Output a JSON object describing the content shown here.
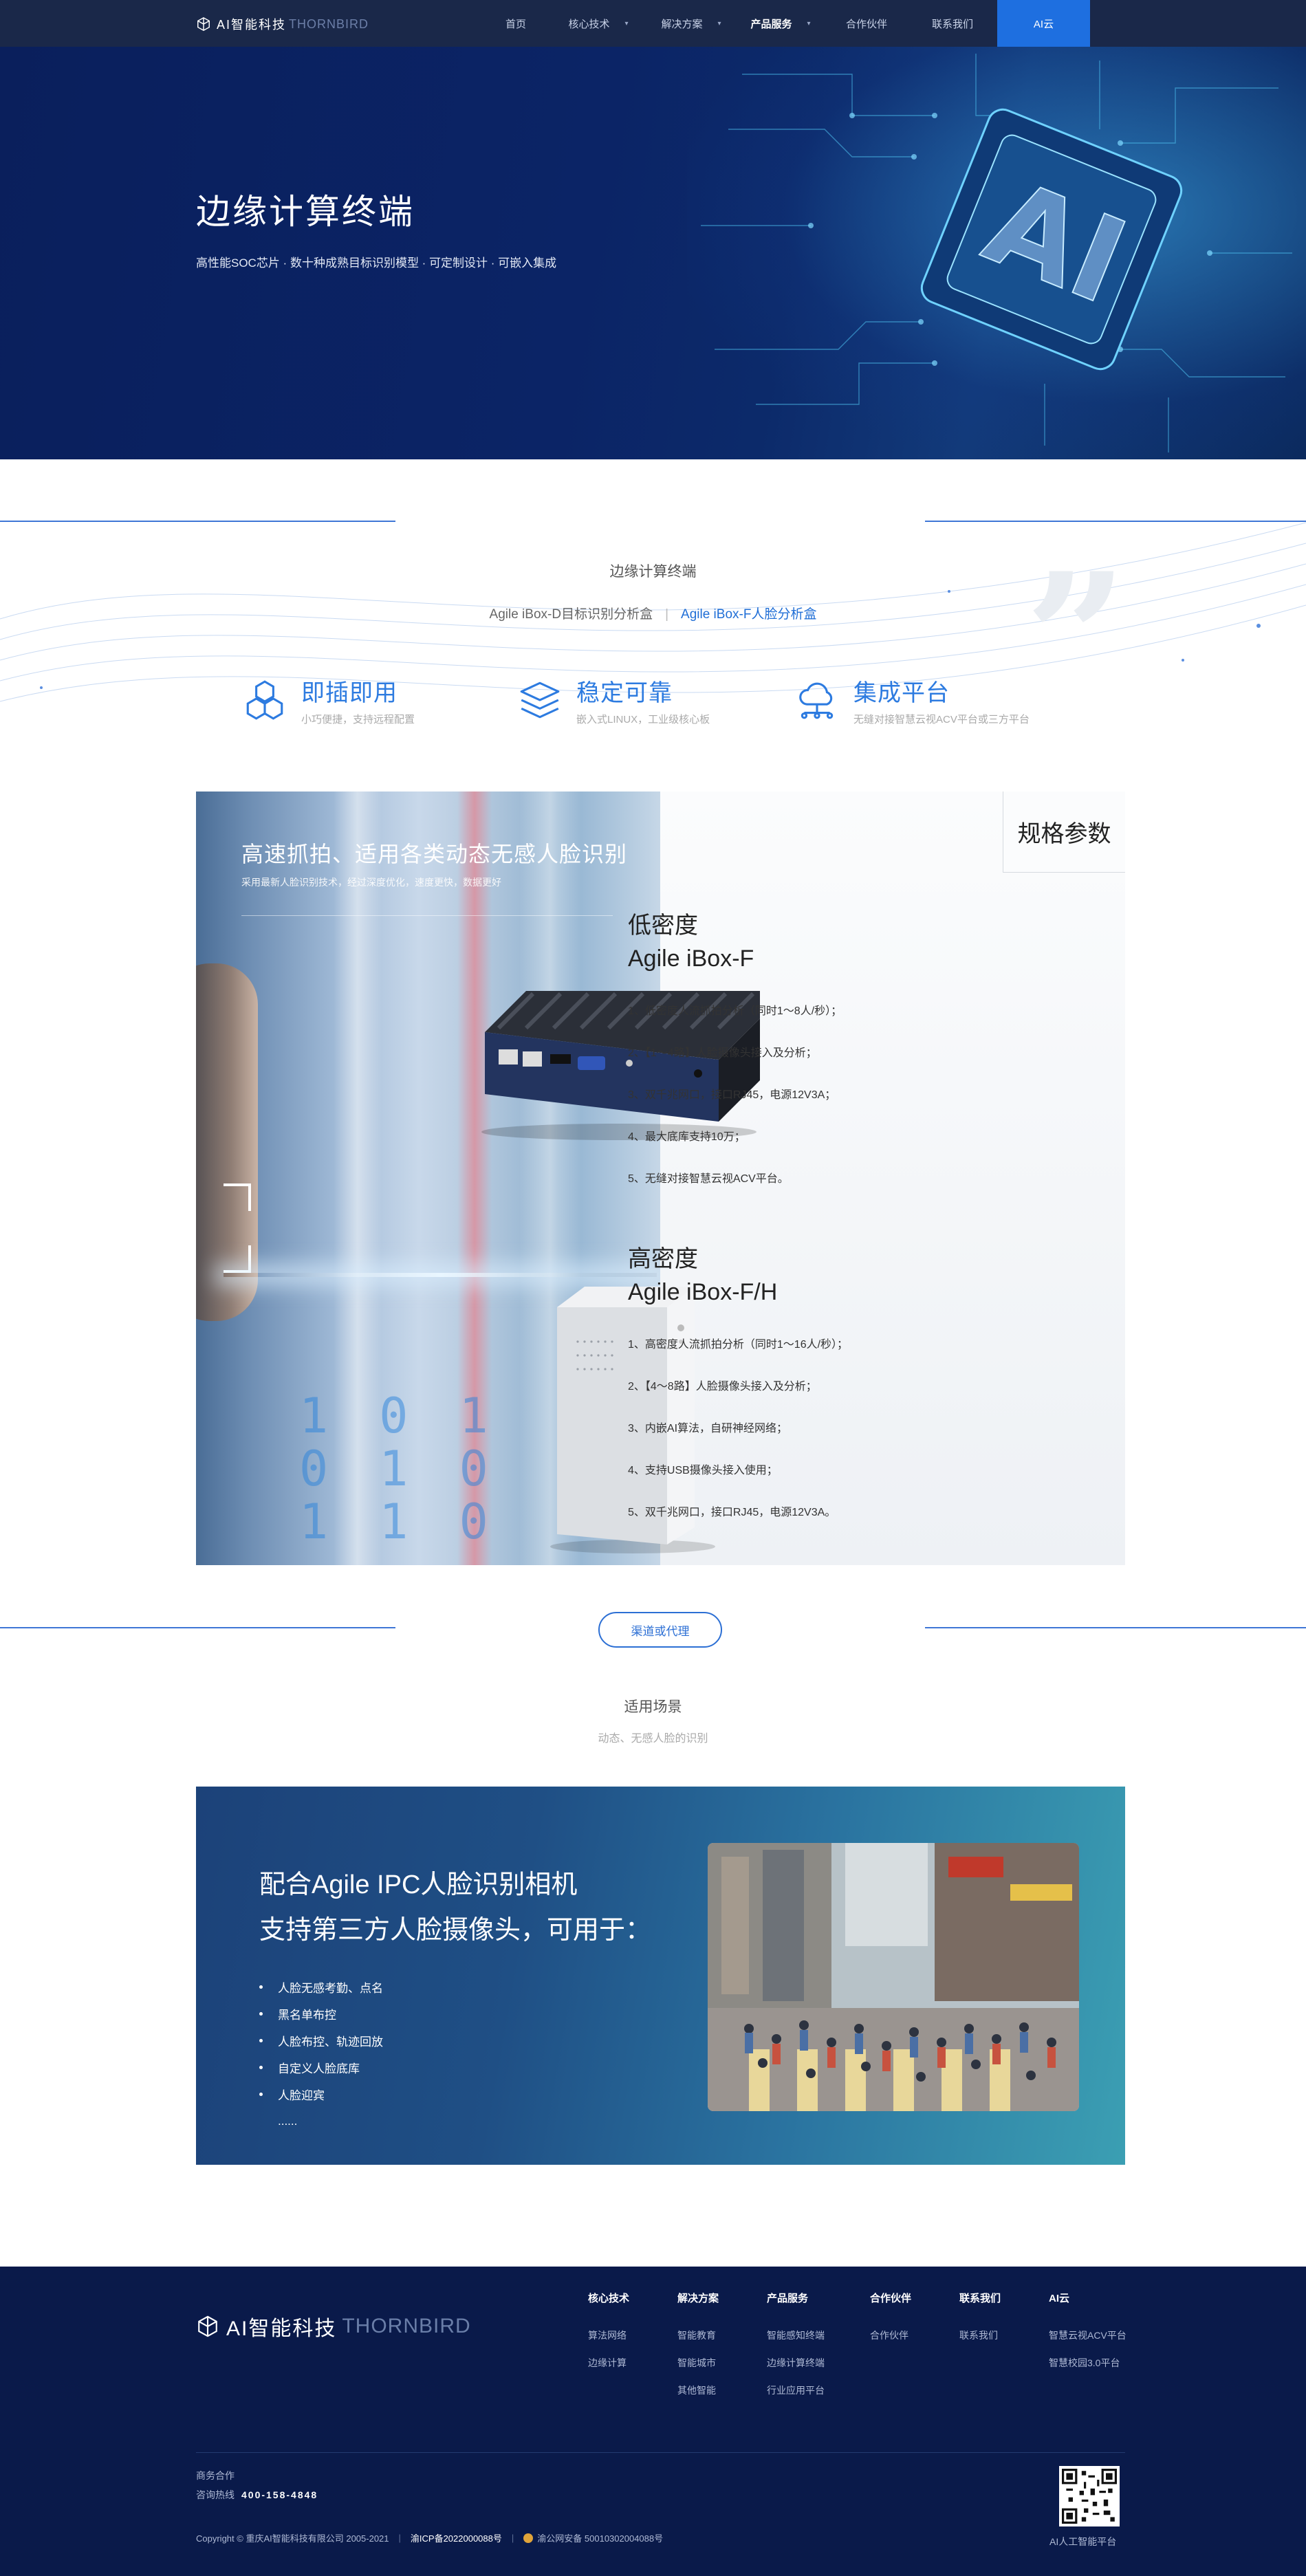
{
  "header": {
    "logo_cn": "AI智能科技",
    "logo_en": "THORNBIRD",
    "nav": [
      {
        "label": "首页"
      },
      {
        "label": "核心技术"
      },
      {
        "label": "解决方案"
      },
      {
        "label": "产品服务"
      },
      {
        "label": "合作伙伴"
      },
      {
        "label": "联系我们"
      },
      {
        "label": "AI云"
      }
    ]
  },
  "hero": {
    "title": "边缘计算终端",
    "subtitle": "高性能SOC芯片 · 数十种成熟目标识别模型 · 可定制设计 · 可嵌入集成"
  },
  "section": {
    "title": "边缘计算终端",
    "tabs": [
      "Agile iBox-D目标识别分析盒",
      "Agile iBox-F人脸分析盒"
    ],
    "tab_separator": "|",
    "active_tab": 1
  },
  "features": [
    {
      "title": "即插即用",
      "desc": "小巧便捷，支持远程配置",
      "icon": "cubes-icon"
    },
    {
      "title": "稳定可靠",
      "desc": "嵌入式LINUX，工业级核心板",
      "icon": "layers-icon"
    },
    {
      "title": "集成平台",
      "desc": "无缝对接智慧云视ACV平台或三方平台",
      "icon": "cloud-network-icon"
    }
  ],
  "product": {
    "headline": "高速抓拍、适用各类动态无感人脸识别",
    "sub": "采用最新人脸识别技术，经过深度优化，速度更快，数据更好",
    "spec_tab": "规格参数",
    "models": [
      {
        "name1": "低密度",
        "name2": "Agile iBox-F",
        "specs": [
          "1、低密度人流抓拍分析（同时1～8人/秒）；",
          "2、【1～4路】人脸摄像头接入及分析；",
          "3、双千兆网口，接口RJ45，电源12V3A；",
          "4、最大底库支持10万；",
          "5、无缝对接智慧云视ACV平台。"
        ]
      },
      {
        "name1": "高密度",
        "name2": "Agile iBox-F/H",
        "specs": [
          "1、高密度人流抓拍分析（同时1～16人/秒）；",
          "2、【4～8路】人脸摄像头接入及分析；",
          "3、内嵌AI算法，自研神经网络；",
          "4、支持USB摄像头接入使用；",
          "5、双千兆网口，接口RJ45，电源12V3A。"
        ]
      }
    ]
  },
  "cta": {
    "label": "渠道或代理"
  },
  "scenario": {
    "title": "适用场景",
    "subtitle": "动态、无感人脸的识别",
    "heading_line1": "配合Agile IPC人脸识别相机",
    "heading_line2": "支持第三方人脸摄像头，可用于：",
    "items": [
      "人脸无感考勤、点名",
      "黑名单布控",
      "人脸布控、轨迹回放",
      "自定义人脸底库",
      "人脸迎宾",
      "......"
    ]
  },
  "footer": {
    "logo_cn": "AI智能科技",
    "logo_en": "THORNBIRD",
    "columns": [
      {
        "head": "核心技术",
        "links": [
          "算法网络",
          "边缘计算"
        ]
      },
      {
        "head": "解决方案",
        "links": [
          "智能教育",
          "智能城市",
          "其他智能"
        ]
      },
      {
        "head": "产品服务",
        "links": [
          "智能感知终端",
          "边缘计算终端",
          "行业应用平台"
        ]
      },
      {
        "head": "合作伙伴",
        "links": [
          "合作伙伴"
        ]
      },
      {
        "head": "联系我们",
        "links": [
          "联系我们"
        ]
      },
      {
        "head": "AI云",
        "links": [
          "智慧云视ACV平台",
          "智慧校园3.0平台"
        ]
      }
    ],
    "contact_label": "商务合作",
    "hotline_label": "咨询热线",
    "hotline": "400-158-4848",
    "copyright": "Copyright © 重庆AI智能科技有限公司 2005-2021",
    "icp": "渝ICP备2022000088号",
    "police": "渝公网安备 50010302004088号",
    "qr_caption": "AI人工智能平台"
  },
  "colors": {
    "accent": "#1e6fe0",
    "navy": "#0a1a4a",
    "feature_blue": "#2d7be0"
  }
}
